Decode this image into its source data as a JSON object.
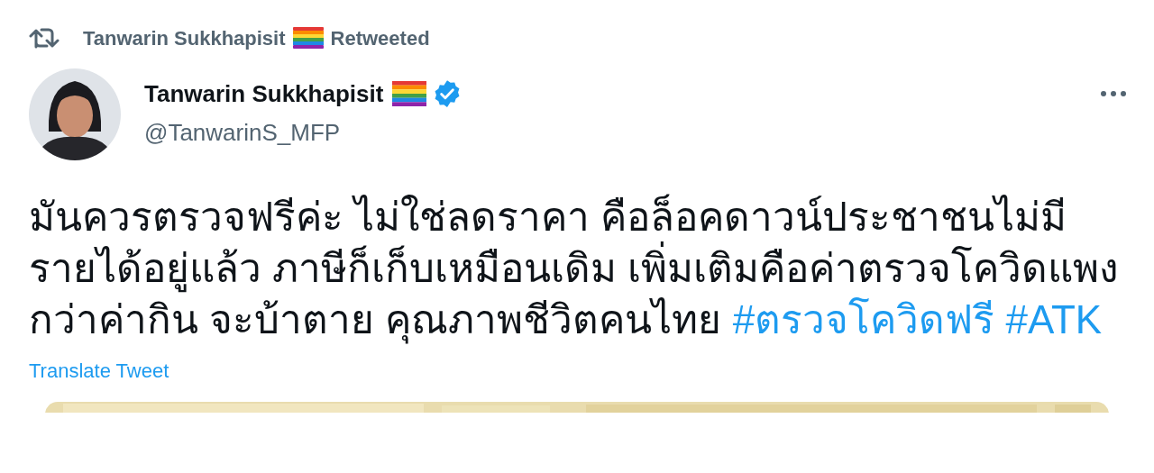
{
  "retweet_header": {
    "name": "Tanwarin Sukkhapisit",
    "label": "Retweeted"
  },
  "author": {
    "name": "Tanwarin Sukkhapisit",
    "handle": "@TanwarinS_MFP",
    "verified": true
  },
  "tweet_text": [
    {
      "kind": "text",
      "text": "มันควรตรวจฟรีค่ะ ไม่ใช่ลดราคา คือล็อคดาวน์ประชาชนไม่มีรายได้อยู่แล้ว ภาษีก็เก็บเหมือนเดิม เพิ่มเติมคือค่าตรวจโควิดแพงกว่าค่ากิน จะบ้าตาย คุณภาพชีวิตคนไทย "
    },
    {
      "kind": "hashtag",
      "text": "#ตรวจโควิดฟรี"
    },
    {
      "kind": "hashtag",
      "text": "#ATK"
    }
  ],
  "translate_link": "Translate Tweet"
}
